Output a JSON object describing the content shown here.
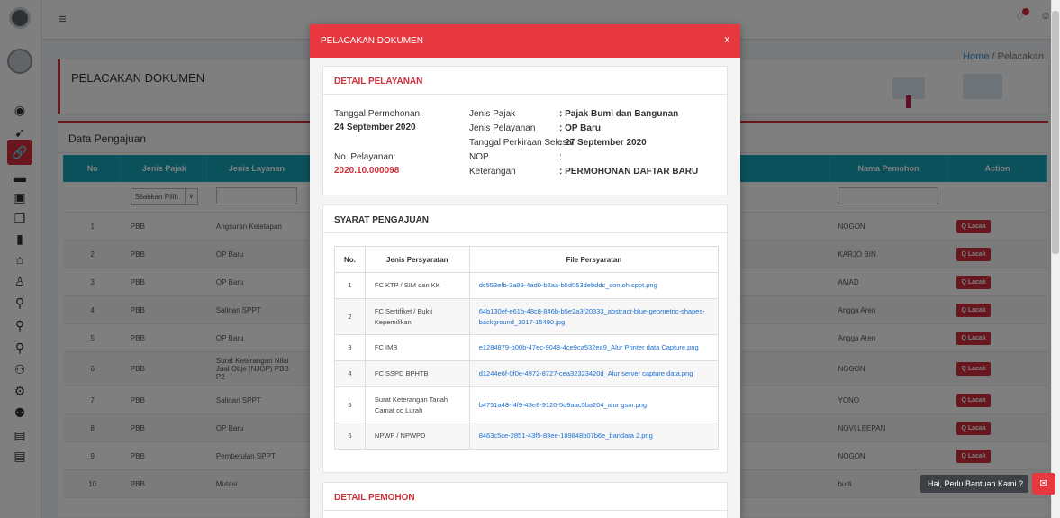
{
  "topbar": {
    "menu_icon": "hamburger-icon",
    "notification_icon": "bell-icon",
    "user_icon": "user-icon"
  },
  "colors": {
    "accent": "#cf2f3a",
    "modal_header": "#e8383f",
    "table_header": "#17a2b8",
    "link": "#1a6fd0"
  },
  "breadcrumb": {
    "home": "Home",
    "separator": "/",
    "current": "Pelacakan"
  },
  "page": {
    "title": "PELACAKAN DOKUMEN"
  },
  "data_card": {
    "title": "Data Pengajuan",
    "columns": [
      "No",
      "Jenis Pajak",
      "Jenis Layanan",
      "Nama Pemohon",
      "Action"
    ],
    "filter_select": "Silahkan Pilih",
    "action_label": "Q Lacak",
    "rows": [
      {
        "no": "1",
        "pajak": "PBB",
        "layanan": "Angsuran Ketetapan",
        "pemohon": "NOGON"
      },
      {
        "no": "2",
        "pajak": "PBB",
        "layanan": "OP Baru",
        "pemohon": "KARJO BIN"
      },
      {
        "no": "3",
        "pajak": "PBB",
        "layanan": "OP Baru",
        "pemohon": "AMAD"
      },
      {
        "no": "4",
        "pajak": "PBB",
        "layanan": "Salinan SPPT",
        "pemohon": "Angga Aren"
      },
      {
        "no": "5",
        "pajak": "PBB",
        "layanan": "OP Baru",
        "pemohon": "Angga Aren"
      },
      {
        "no": "6",
        "pajak": "PBB",
        "layanan": "Surat Keterangan Nilai Jual Obje (NJOP) PBB P2",
        "pemohon": "NOGON"
      },
      {
        "no": "7",
        "pajak": "PBB",
        "layanan": "Salinan SPPT",
        "pemohon": "YONO"
      },
      {
        "no": "8",
        "pajak": "PBB",
        "layanan": "OP Baru",
        "pemohon": "NOVI LEEPAN"
      },
      {
        "no": "9",
        "pajak": "PBB",
        "layanan": "Pembetulan SPPT",
        "pemohon": "NOGON"
      },
      {
        "no": "10",
        "pajak": "PBB",
        "layanan": "Mutasi",
        "pemohon": "budi"
      }
    ]
  },
  "modal": {
    "title": "PELACAKAN DOKUMEN",
    "close": "x",
    "detail_pelayanan": {
      "title": "DETAIL PELAYANAN",
      "tanggal_label": "Tanggal Permohonan:",
      "tanggal_value": "24 September 2020",
      "no_label": "No. Pelayanan:",
      "no_value": "2020.10.000098",
      "jenis_pajak_label": "Jenis Pajak",
      "jenis_pajak_value": ": Pajak Bumi dan Bangunan",
      "jenis_pelayanan_label": "Jenis Pelayanan",
      "jenis_pelayanan_value": ": OP Baru",
      "perkiraan_label": "Tanggal Perkiraan Selesai",
      "perkiraan_value": ": 27 September 2020",
      "nop_label": "NOP",
      "nop_value": ":",
      "keterangan_label": "Keterangan",
      "keterangan_value": ": PERMOHONAN DAFTAR BARU"
    },
    "syarat": {
      "title": "SYARAT PENGAJUAN",
      "columns": [
        "No.",
        "Jenis Persyaratan",
        "File Persyaratan"
      ],
      "rows": [
        {
          "no": "1",
          "jenis": "FC KTP / SIM dan KK",
          "file": "dc553efb-3a99-4ad0-b2aa-b5d053debddc_contoh sppt.png"
        },
        {
          "no": "2",
          "jenis": "FC Sertifiket / Bukti Kepemilikan",
          "file": "64b130ef-e61b-48c8-846b-b5e2a3f20333_abstract-blue-geometric-shapes-background_1017-15490.jpg"
        },
        {
          "no": "3",
          "jenis": "FC IMB",
          "file": "e1284879-b00b-47ec-9048-4ce9ca532ea9_Alur Printer data Capture.png"
        },
        {
          "no": "4",
          "jenis": "FC SSPD BPHTB",
          "file": "d1244e6f-0f0e-4972-8727-cea32323420d_Alur server capture data.png"
        },
        {
          "no": "5",
          "jenis": "Surat Keterangan Tanah Camat cq Lurah",
          "file": "b4751a48-f4f9-43e8-9120-5d9aac5ba204_alur gsm.png"
        },
        {
          "no": "6",
          "jenis": "NPWP / NPWPD",
          "file": "8463c5ce-2851-43f5-83ee-189848b07b6e_bandara 2.png"
        }
      ]
    },
    "detail_pemohon": {
      "title": "DETAIL PEMOHON"
    }
  },
  "chat": {
    "label": "Hai, Perlu Bantuan Kami ?",
    "icon": "chat-icon"
  }
}
